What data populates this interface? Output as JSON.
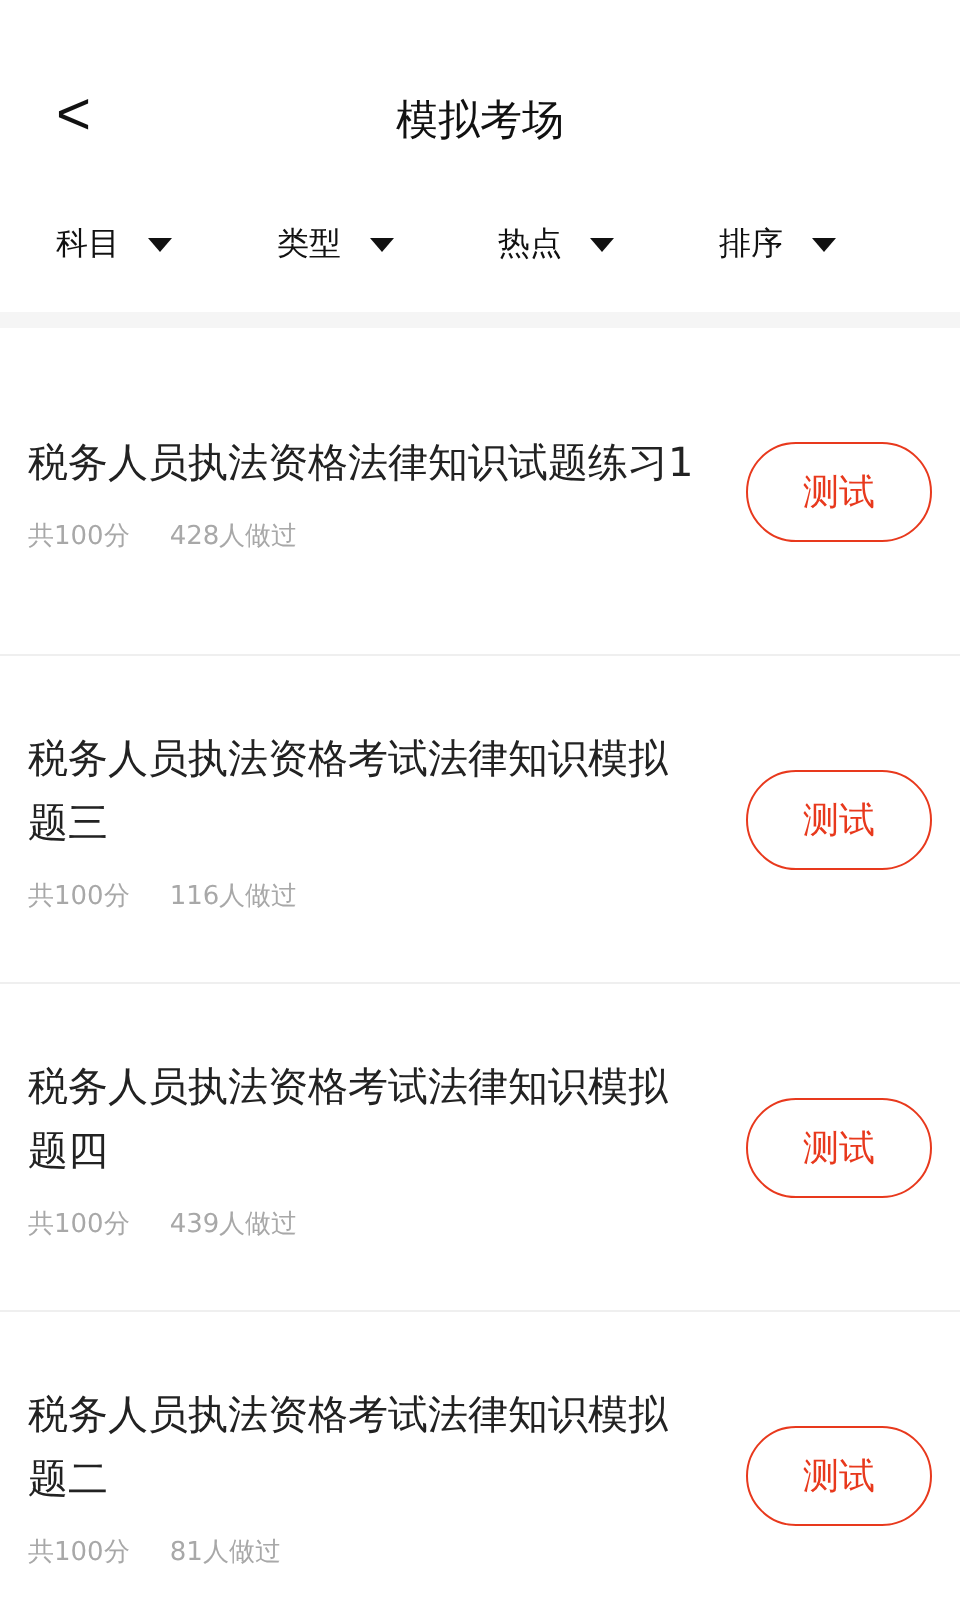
{
  "header": {
    "back": "<",
    "title": "模拟考场"
  },
  "filters": [
    {
      "label": "科目"
    },
    {
      "label": "类型"
    },
    {
      "label": "热点"
    },
    {
      "label": "排序"
    }
  ],
  "items": [
    {
      "title": "税务人员执法资格法律知识试题练习1",
      "score": "共100分",
      "count": "428人做过",
      "button": "测试"
    },
    {
      "title": "税务人员执法资格考试法律知识模拟题三",
      "score": "共100分",
      "count": "116人做过",
      "button": "测试"
    },
    {
      "title": "税务人员执法资格考试法律知识模拟题四",
      "score": "共100分",
      "count": "439人做过",
      "button": "测试"
    },
    {
      "title": "税务人员执法资格考试法律知识模拟题二",
      "score": "共100分",
      "count": "81人做过",
      "button": "测试"
    }
  ]
}
